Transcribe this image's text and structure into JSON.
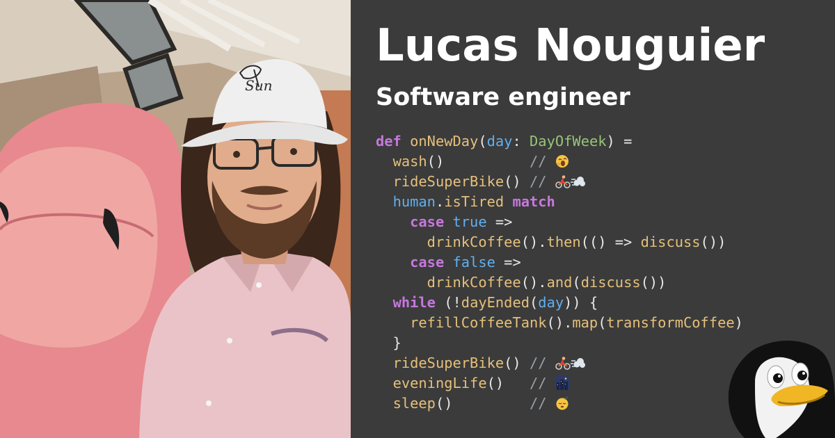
{
  "header": {
    "name": "Lucas Nouguier",
    "role": "Software engineer"
  },
  "photo": {
    "hat_text": "Sun"
  },
  "code": {
    "lines": [
      [
        {
          "k": "kw",
          "t": "def"
        },
        {
          "k": "pn",
          "t": " "
        },
        {
          "k": "fn",
          "t": "onNewDay"
        },
        {
          "k": "pn",
          "t": "("
        },
        {
          "k": "id",
          "t": "day"
        },
        {
          "k": "pn",
          "t": ": "
        },
        {
          "k": "ty",
          "t": "DayOfWeek"
        },
        {
          "k": "pn",
          "t": ") ="
        }
      ],
      [
        {
          "k": "pn",
          "t": "  "
        },
        {
          "k": "fn",
          "t": "wash"
        },
        {
          "k": "pn",
          "t": "()"
        },
        {
          "k": "pn",
          "t": "          "
        },
        {
          "k": "cm",
          "t": "// "
        },
        {
          "k": "emoji",
          "t": "yawn-emoji"
        }
      ],
      [
        {
          "k": "pn",
          "t": "  "
        },
        {
          "k": "fn",
          "t": "rideSuperBike"
        },
        {
          "k": "pn",
          "t": "()"
        },
        {
          "k": "pn",
          "t": " "
        },
        {
          "k": "cm",
          "t": "// "
        },
        {
          "k": "emoji",
          "t": "cyclist-emoji"
        },
        {
          "k": "emoji",
          "t": "dash-emoji"
        }
      ],
      [
        {
          "k": "pn",
          "t": "  "
        },
        {
          "k": "id",
          "t": "human"
        },
        {
          "k": "pn",
          "t": "."
        },
        {
          "k": "fn",
          "t": "isTired"
        },
        {
          "k": "pn",
          "t": " "
        },
        {
          "k": "kw",
          "t": "match"
        }
      ],
      [
        {
          "k": "pn",
          "t": "    "
        },
        {
          "k": "kw",
          "t": "case"
        },
        {
          "k": "pn",
          "t": " "
        },
        {
          "k": "id",
          "t": "true"
        },
        {
          "k": "pn",
          "t": " =>"
        }
      ],
      [
        {
          "k": "pn",
          "t": "      "
        },
        {
          "k": "fn",
          "t": "drinkCoffee"
        },
        {
          "k": "pn",
          "t": "()."
        },
        {
          "k": "fn",
          "t": "then"
        },
        {
          "k": "pn",
          "t": "(() => "
        },
        {
          "k": "fn",
          "t": "discuss"
        },
        {
          "k": "pn",
          "t": "())"
        }
      ],
      [
        {
          "k": "pn",
          "t": "    "
        },
        {
          "k": "kw",
          "t": "case"
        },
        {
          "k": "pn",
          "t": " "
        },
        {
          "k": "id",
          "t": "false"
        },
        {
          "k": "pn",
          "t": " =>"
        }
      ],
      [
        {
          "k": "pn",
          "t": "      "
        },
        {
          "k": "fn",
          "t": "drinkCoffee"
        },
        {
          "k": "pn",
          "t": "()."
        },
        {
          "k": "fn",
          "t": "and"
        },
        {
          "k": "pn",
          "t": "("
        },
        {
          "k": "fn",
          "t": "discuss"
        },
        {
          "k": "pn",
          "t": "())"
        }
      ],
      [
        {
          "k": "pn",
          "t": "  "
        },
        {
          "k": "kw",
          "t": "while"
        },
        {
          "k": "pn",
          "t": " (!"
        },
        {
          "k": "fn",
          "t": "dayEnded"
        },
        {
          "k": "pn",
          "t": "("
        },
        {
          "k": "id",
          "t": "day"
        },
        {
          "k": "pn",
          "t": ")) {"
        }
      ],
      [
        {
          "k": "pn",
          "t": "    "
        },
        {
          "k": "fn",
          "t": "refillCoffeeTank"
        },
        {
          "k": "pn",
          "t": "()."
        },
        {
          "k": "fn",
          "t": "map"
        },
        {
          "k": "pn",
          "t": "("
        },
        {
          "k": "fn",
          "t": "transformCoffee"
        },
        {
          "k": "pn",
          "t": ")"
        }
      ],
      [
        {
          "k": "pn",
          "t": "  }"
        }
      ],
      [
        {
          "k": "pn",
          "t": "  "
        },
        {
          "k": "fn",
          "t": "rideSuperBike"
        },
        {
          "k": "pn",
          "t": "()"
        },
        {
          "k": "pn",
          "t": " "
        },
        {
          "k": "cm",
          "t": "// "
        },
        {
          "k": "emoji",
          "t": "cyclist-emoji"
        },
        {
          "k": "emoji",
          "t": "dash-emoji"
        }
      ],
      [
        {
          "k": "pn",
          "t": "  "
        },
        {
          "k": "fn",
          "t": "eveningLife"
        },
        {
          "k": "pn",
          "t": "()"
        },
        {
          "k": "pn",
          "t": "   "
        },
        {
          "k": "cm",
          "t": "// "
        },
        {
          "k": "emoji",
          "t": "night-city-emoji"
        }
      ],
      [
        {
          "k": "pn",
          "t": "  "
        },
        {
          "k": "fn",
          "t": "sleep"
        },
        {
          "k": "pn",
          "t": "()"
        },
        {
          "k": "pn",
          "t": "         "
        },
        {
          "k": "cm",
          "t": "// "
        },
        {
          "k": "emoji",
          "t": "sleeping-face-emoji"
        }
      ]
    ]
  },
  "colors": {
    "background": "#3b3b3b",
    "keyword": "#c678dd",
    "function": "#e5c07b",
    "type": "#98c379",
    "identifier": "#61afef",
    "comment": "#9aa0a6",
    "title": "#ffffff"
  },
  "icons": {
    "mascot": "penguin-icon"
  }
}
